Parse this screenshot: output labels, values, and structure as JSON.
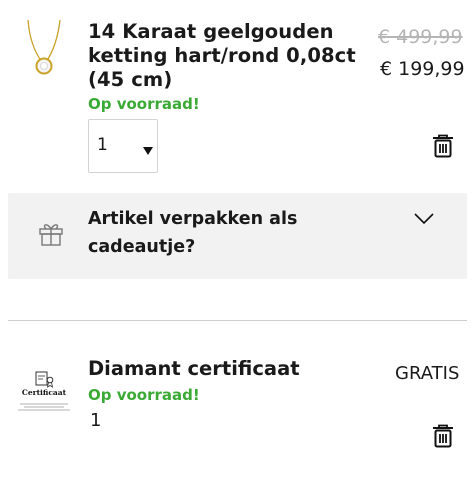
{
  "items": [
    {
      "title_line1": "14 Karaat geelgouden",
      "title_line2": "ketting hart/rond 0,08ct",
      "title_line3": "(45 cm)",
      "old_price": "€ 499,99",
      "price": "€ 199,99",
      "stock": "Op voorraad!",
      "quantity": "1",
      "image_icon": "necklace-icon",
      "delete_icon": "trash-icon"
    },
    {
      "title": "Diamant certificaat",
      "price": "GRATIS",
      "stock": "Op voorraad!",
      "quantity": "1",
      "image_icon": "certificate-icon",
      "image_text": "Certificaat",
      "delete_icon": "trash-icon"
    }
  ],
  "gift": {
    "label_line1": "Artikel verpakken als",
    "label_line2": "cadeautje?",
    "icon": "gift-icon",
    "toggle_icon": "chevron-down-icon"
  },
  "colors": {
    "stock_green": "#3aaa35",
    "strike_grey": "#b5b5b5",
    "gift_bg": "#f2f2f2"
  }
}
